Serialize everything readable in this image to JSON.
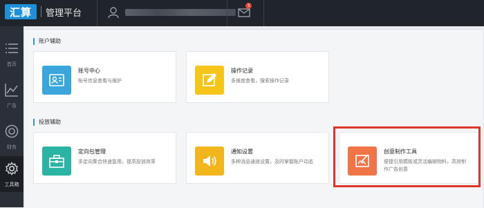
{
  "header": {
    "logo_text": "汇算",
    "title": "管理平台",
    "mail_badge": "3"
  },
  "sidebar": {
    "items": [
      {
        "label": "首页",
        "icon": "list-icon"
      },
      {
        "label": "广告",
        "icon": "chart-icon"
      },
      {
        "label": "财务",
        "icon": "finance-icon"
      },
      {
        "label": "工具箱",
        "icon": "gear-icon"
      }
    ]
  },
  "sections": [
    {
      "title": "账户辅助",
      "cards": [
        {
          "title": "账号中心",
          "desc": "账号信息查看与维护",
          "color": "#3aa7dc",
          "icon": "id-card-icon"
        },
        {
          "title": "操作记录",
          "desc": "多维度查看，搜索操作记录",
          "color": "#f5c518",
          "icon": "edit-icon"
        }
      ]
    },
    {
      "title": "投放辅助",
      "cards": [
        {
          "title": "定向包管理",
          "desc": "多定向集合快速复用，提高投放效率",
          "color": "#2bb3a3",
          "icon": "toolbox-icon"
        },
        {
          "title": "通知设置",
          "desc": "多种消息通道设置，及时掌握账户动态",
          "color": "#f2b51c",
          "icon": "speaker-icon"
        },
        {
          "title": "创意制作工具",
          "desc": "便捷引用模板或灵活编辑物料，高效制",
          "desc2": "作广告创意",
          "color": "#f07445",
          "icon": "creative-icon"
        }
      ]
    }
  ],
  "colors": {
    "highlight": "#e0352b",
    "accent": "#2f93e0"
  }
}
